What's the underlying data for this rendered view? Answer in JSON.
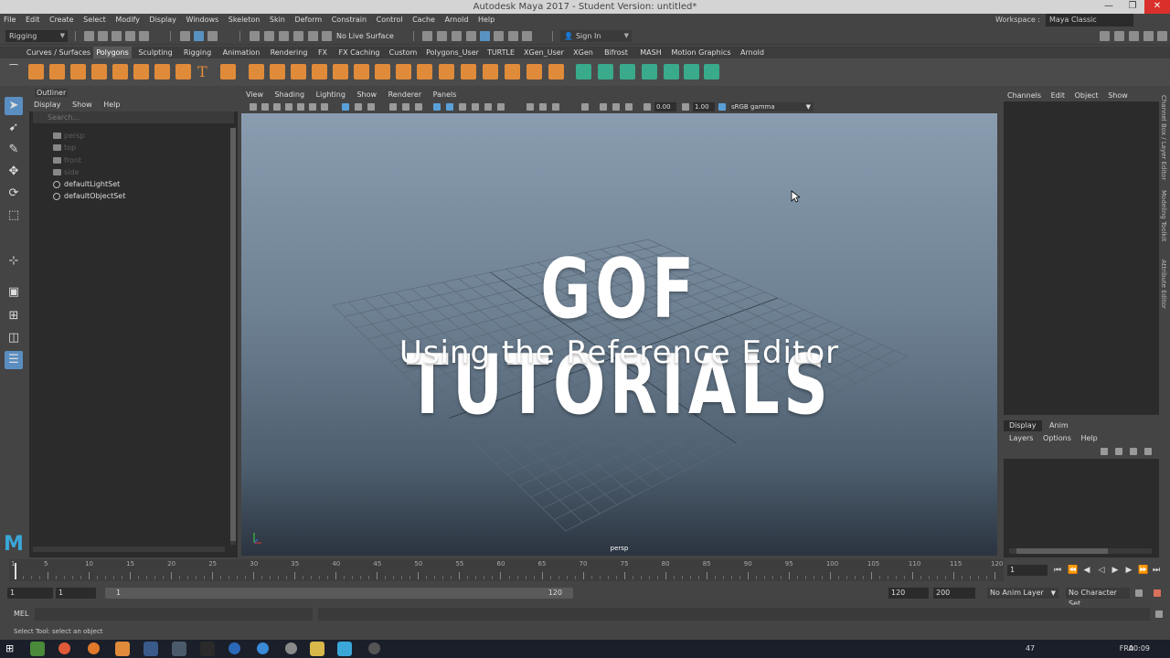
{
  "window": {
    "title": "Autodesk Maya 2017 - Student Version: untitled*",
    "minimize": "—",
    "restore": "❐",
    "close": "✕"
  },
  "menubar": {
    "items": [
      "File",
      "Edit",
      "Create",
      "Select",
      "Modify",
      "Display",
      "Windows",
      "Skeleton",
      "Skin",
      "Deform",
      "Constrain",
      "Control",
      "Cache",
      "Arnold",
      "Help"
    ],
    "workspace_label": "Workspace :",
    "workspace_value": "Maya Classic"
  },
  "statusline": {
    "menuset": "Rigging",
    "live_surface": "No Live Surface",
    "sign_in": "Sign In"
  },
  "shelf": {
    "tabs": [
      "Curves / Surfaces",
      "Polygons",
      "Sculpting",
      "Rigging",
      "Animation",
      "Rendering",
      "FX",
      "FX Caching",
      "Custom",
      "Polygons_User",
      "TURTLE",
      "XGen_User",
      "XGen",
      "Bifrost",
      "MASH",
      "Motion Graphics",
      "Arnold"
    ],
    "active_tab": "Polygons",
    "icon_colors": {
      "orange": "#e08b3a",
      "teal": "#3aaa8c"
    }
  },
  "toolbox": {
    "tools": [
      "select-tool-icon",
      "lasso-tool-icon",
      "paint-select-icon",
      "move-tool-icon",
      "rotate-tool-icon",
      "scale-tool-icon",
      "last-tool-icon",
      "layout-single-icon",
      "layout-four-icon",
      "layout-two-icon",
      "outliner-layout-icon"
    ],
    "logo": "M"
  },
  "outliner": {
    "title": "Outliner",
    "menu": [
      "Display",
      "Show",
      "Help"
    ],
    "search_placeholder": "Search...",
    "items": [
      {
        "label": "persp",
        "dim": true,
        "type": "camera"
      },
      {
        "label": "top",
        "dim": true,
        "type": "camera"
      },
      {
        "label": "front",
        "dim": true,
        "type": "camera"
      },
      {
        "label": "side",
        "dim": true,
        "type": "camera"
      },
      {
        "label": "defaultLightSet",
        "dim": false,
        "type": "set"
      },
      {
        "label": "defaultObjectSet",
        "dim": false,
        "type": "set"
      }
    ]
  },
  "viewport": {
    "menu": [
      "View",
      "Shading",
      "Lighting",
      "Show",
      "Renderer",
      "Panels"
    ],
    "exposure": "0.00",
    "gamma": "1.00",
    "color_space": "sRGB gamma",
    "title": "GOF TUTORIALS",
    "subtitle": "Using the Reference Editor",
    "camera": "persp"
  },
  "channelbox": {
    "menu": [
      "Channels",
      "Edit",
      "Object",
      "Show"
    ],
    "side_tabs": [
      "Channel Box / Layer Editor",
      "Modeling Toolkit",
      "Attribute Editor"
    ]
  },
  "layers": {
    "tabs": [
      "Display",
      "Anim"
    ],
    "active_tab": "Display",
    "menu": [
      "Layers",
      "Options",
      "Help"
    ]
  },
  "timeslider": {
    "labels": [
      "1",
      "5",
      "10",
      "15",
      "20",
      "25",
      "30",
      "35",
      "40",
      "45",
      "50",
      "55",
      "60",
      "65",
      "70",
      "75",
      "80",
      "85",
      "90",
      "95",
      "100",
      "105",
      "110",
      "115",
      "120"
    ],
    "current_frame": "1"
  },
  "rangeslider": {
    "start": "1",
    "playback_start": "1",
    "bar_start": "1",
    "bar_end": "120",
    "playback_end": "120",
    "end": "200",
    "anim_layer": "No Anim Layer",
    "character_set": "No Character Set"
  },
  "commandline": {
    "language": "MEL",
    "help": "Select Tool: select an object"
  },
  "taskbar": {
    "language": "FRA",
    "tray_count": "47",
    "time": "00:09"
  }
}
